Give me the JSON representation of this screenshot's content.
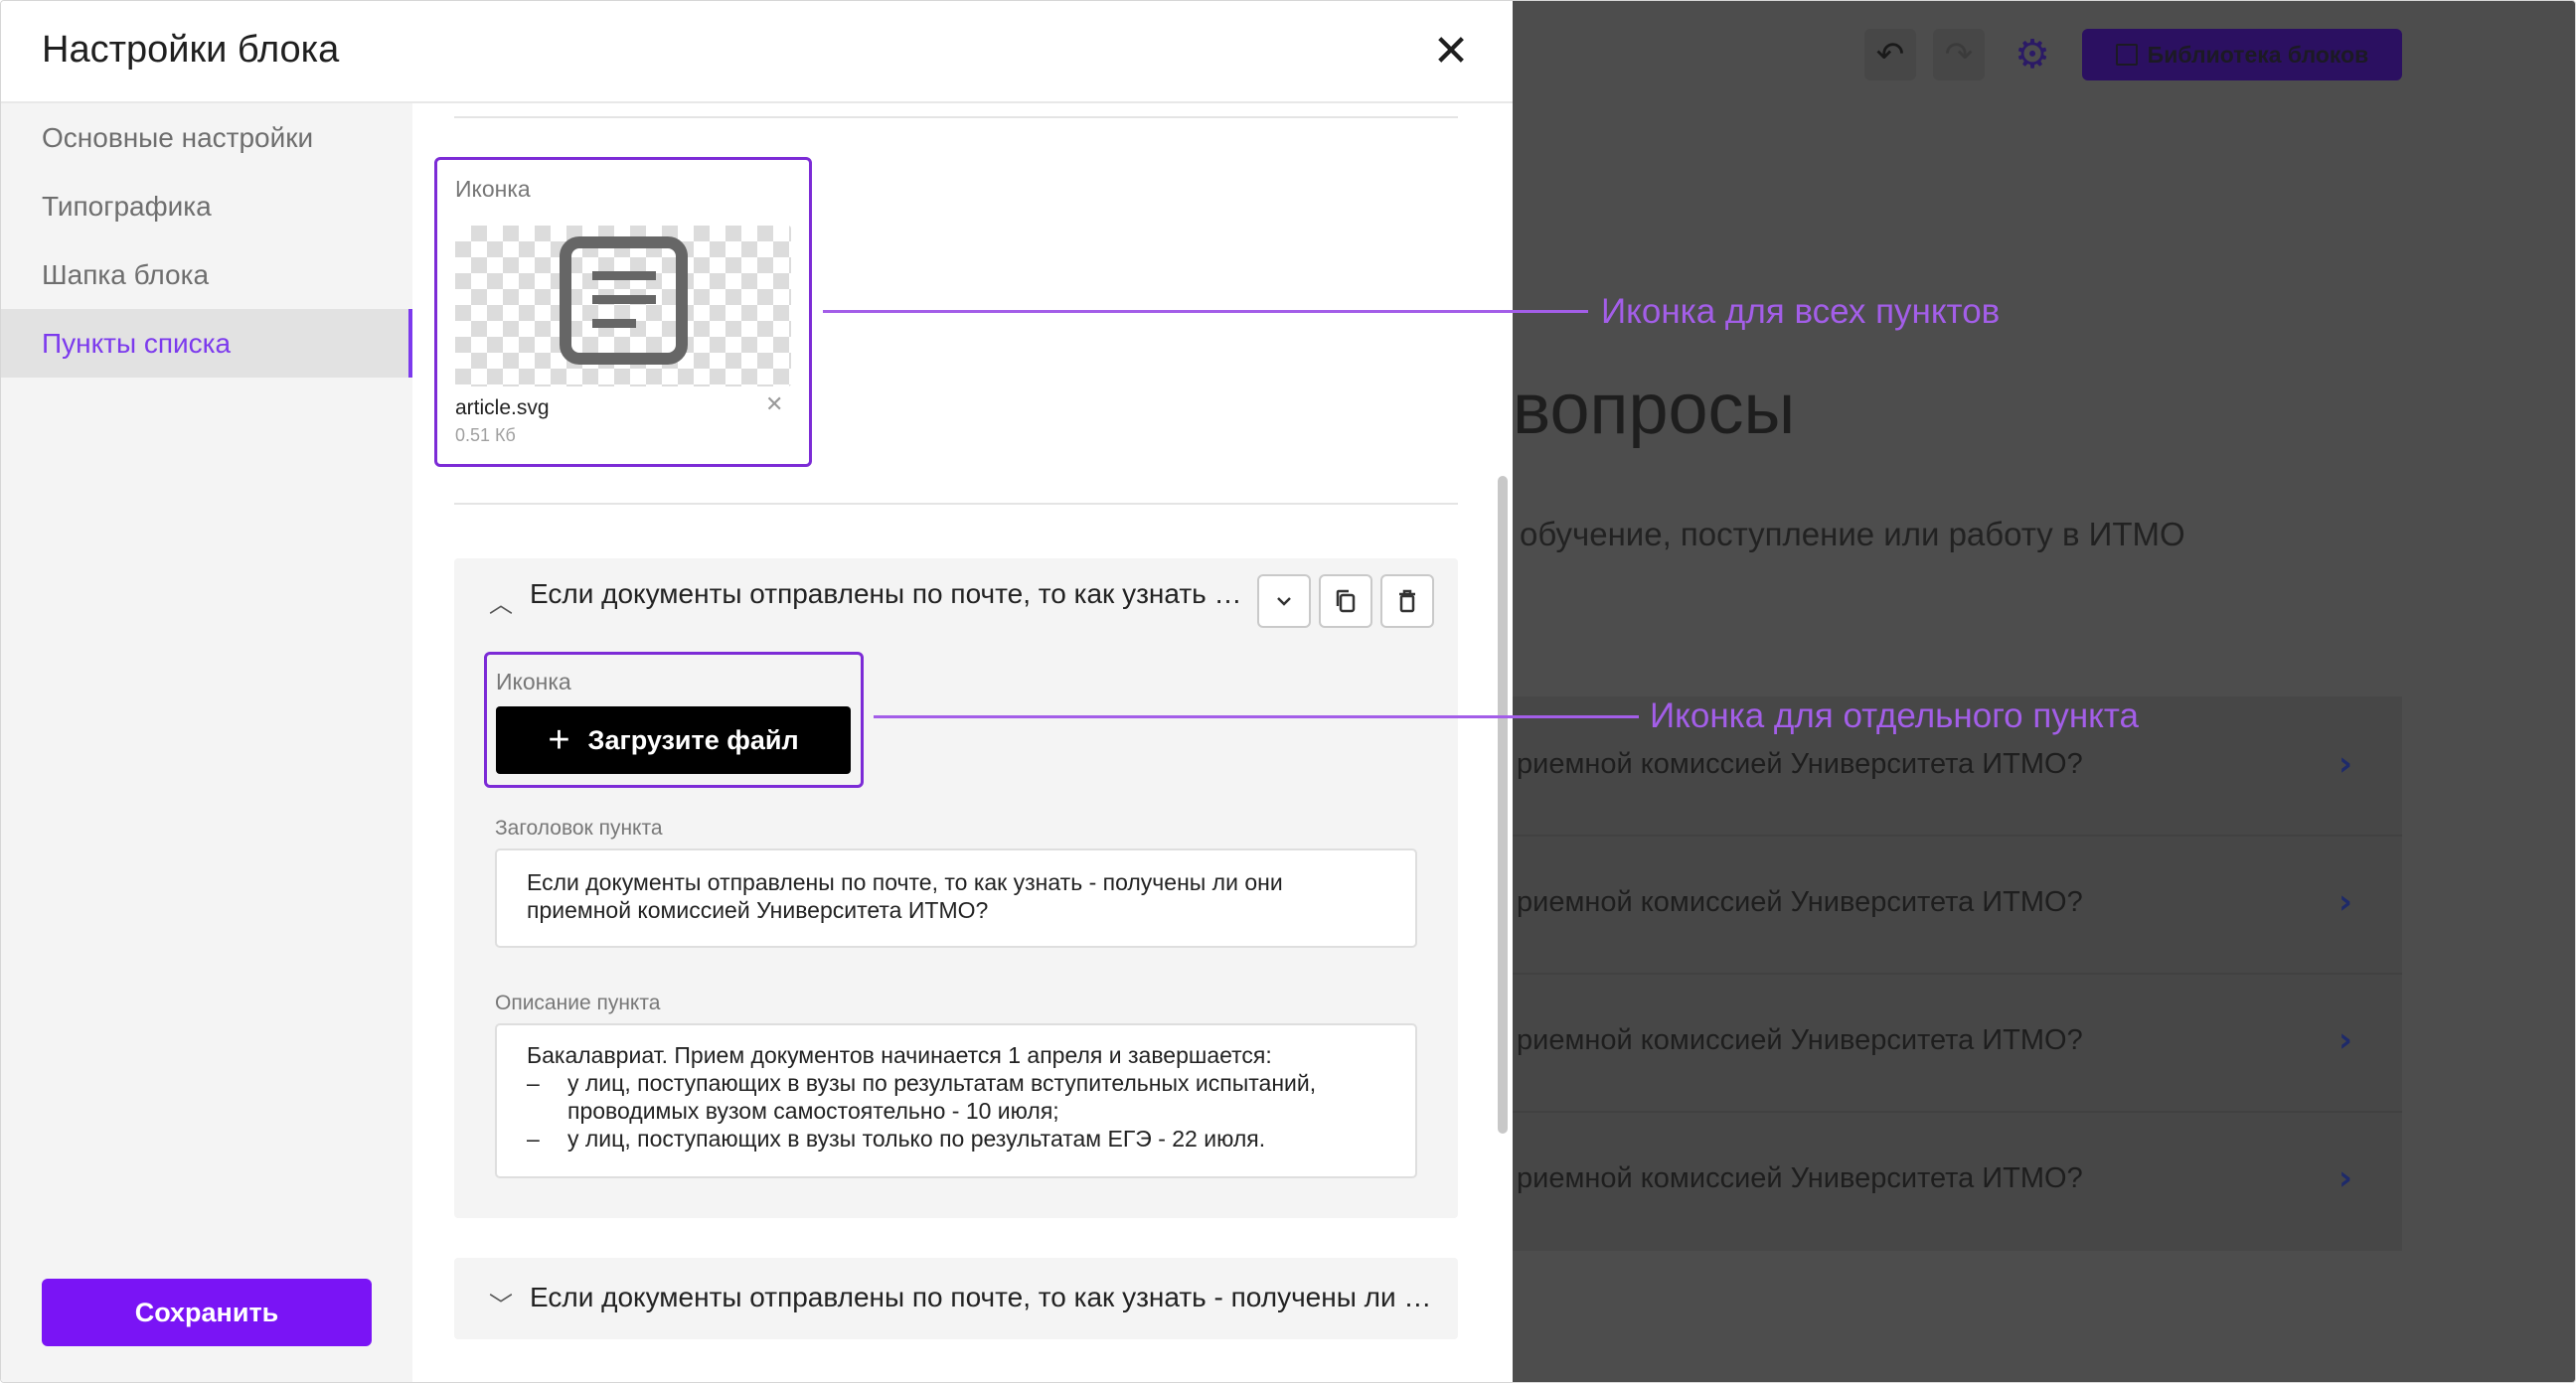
{
  "modal": {
    "title": "Настройки блока",
    "nav": [
      {
        "label": "Основные настройки",
        "active": false
      },
      {
        "label": "Типографика",
        "active": false
      },
      {
        "label": "Шапка блока",
        "active": false
      },
      {
        "label": "Пункты списка",
        "active": true
      }
    ],
    "save_label": "Сохранить"
  },
  "list_icon": {
    "label": "Иконка",
    "file_name": "article.svg",
    "file_size": "0.51 Кб",
    "preview_icon": "article-icon"
  },
  "item": {
    "title": "Если документы отправлены по почте, то как узнать - получены ли они приемной комиссией Университета ИТМО?",
    "actions": [
      "chevron-down-icon",
      "copy-icon",
      "trash-icon"
    ],
    "icon_label": "Иконка",
    "upload_label": "Загрузите файл",
    "heading_label": "Заголовок пункта",
    "heading_value": "Если документы отправлены по почте, то как узнать - получены ли они приемной комиссией Университета ИТМО?",
    "description_label": "Описание пункта",
    "description_intro": "Бакалавриат. Прием документов начинается 1 апреля и завершается:",
    "description_bullets": [
      "у лиц, поступающих в вузы по результатам вступительных испытаний, проводимых вузом самостоятельно - 10 июля;",
      "у лиц, поступающих в вузы только по результатам ЕГЭ - 22 июля."
    ]
  },
  "item2": {
    "title": "Если документы отправлены по почте, то как узнать - получены ли они приемной комиссией Университета ИТМО?"
  },
  "annotations": {
    "all_items": "Иконка для всех пунктов",
    "single_item": "Иконка для отдельного пункта"
  },
  "background": {
    "library_label": "Библиотека блоков",
    "title_fragment": "вопросы",
    "subtitle_fragment": "обучение, поступление или работу в ИТМО",
    "rows": [
      "риемной комиссией Университета ИТМО?",
      "риемной комиссией Университета ИТМО?",
      "риемной комиссией Университета ИТМО?",
      "риемной комиссией Университета ИТМО?"
    ]
  },
  "colors": {
    "accent": "#7a14f5",
    "annotation": "#a35ee8",
    "frame_border": "#7c2bd6"
  }
}
